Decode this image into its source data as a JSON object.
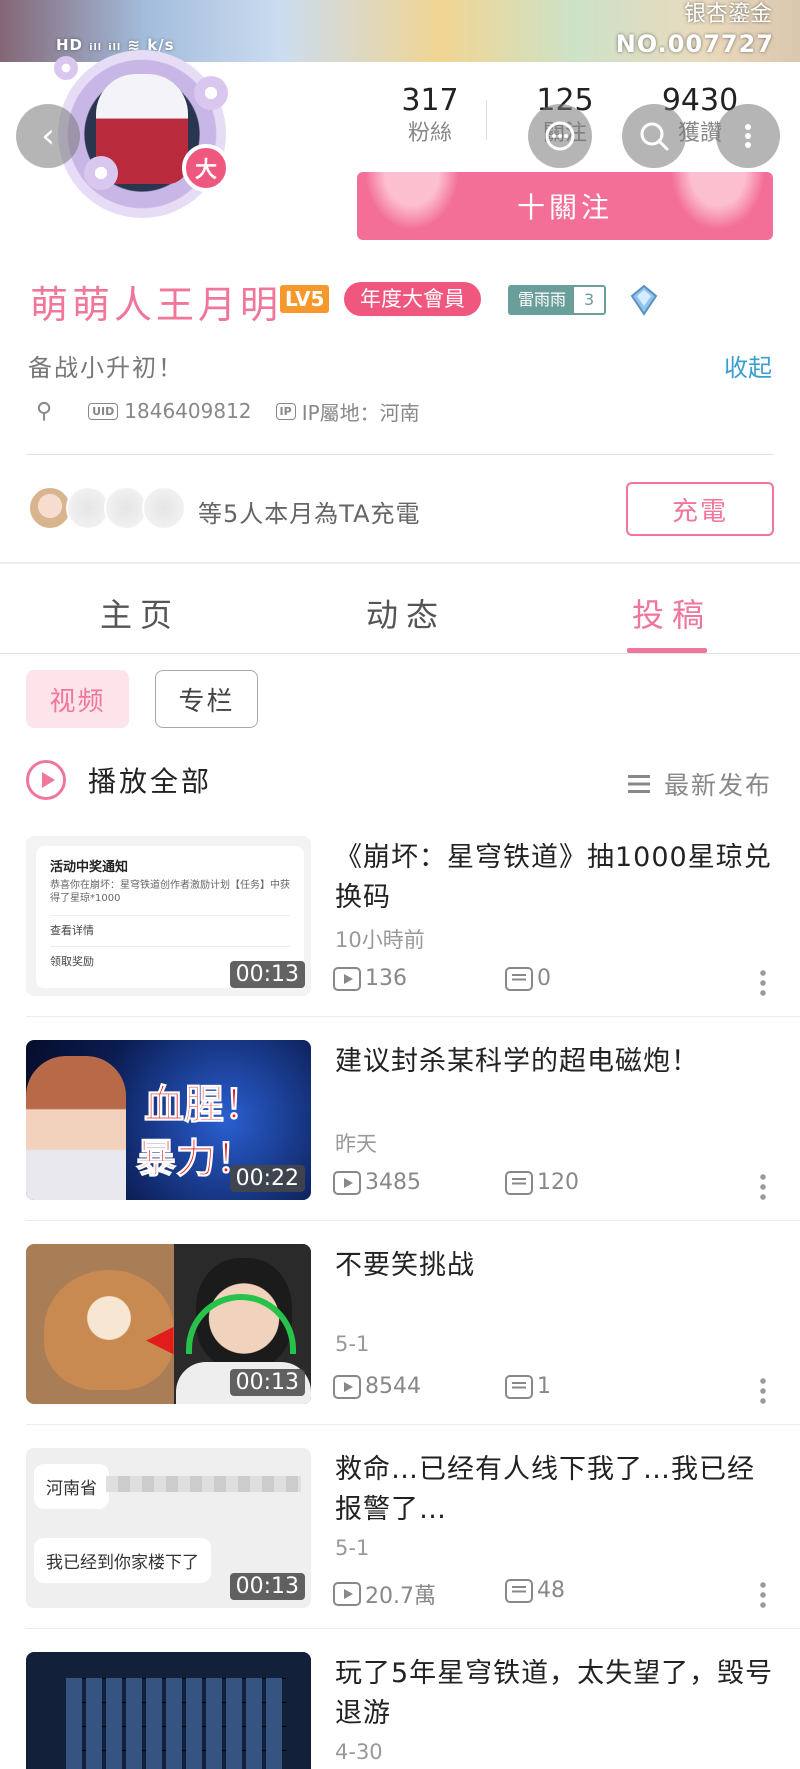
{
  "banner": {
    "medal_label": "银杏鎏金",
    "status_left": "HD ᵢₗₗ ᵢₗₗ ≋ k/s",
    "medal_number": "NO.007727"
  },
  "header": {
    "avatar_badge": "大",
    "stats": [
      {
        "num": "317",
        "label": "粉絲"
      },
      {
        "num": "125",
        "label": "關注"
      },
      {
        "num": "9430",
        "label": "獲讚"
      }
    ],
    "follow_label": "十關注"
  },
  "profile": {
    "name": "萌萌人王月明",
    "level": "LV5",
    "vip": "年度大會員",
    "fan_badge_name": "雷雨雨",
    "fan_badge_level": "3",
    "bio": "备战小升初！",
    "collapse_label": "收起",
    "uid_tag": "UID",
    "uid": "1846409812",
    "ip_tag": "IP",
    "ip": "IP屬地：河南"
  },
  "charge": {
    "text": "等5人本月為TA充電",
    "button": "充電"
  },
  "tabs": [
    {
      "label": "主页"
    },
    {
      "label": "动态"
    },
    {
      "label": "投稿"
    }
  ],
  "subtabs": {
    "video": "视频",
    "column": "专栏"
  },
  "list_header": {
    "play_all": "播放全部",
    "sort": "最新发布"
  },
  "videos": [
    {
      "title": "《崩坏：星穹铁道》抽1000星琼兑换码",
      "time": "10小時前",
      "plays": "136",
      "comments": "0",
      "duration": "00:13",
      "thumb_head": "活动中奖通知",
      "thumb_body": "恭喜你在崩坏：星穹铁道创作者激励计划【任务】中获得了星琼*1000",
      "thumb_row1": "查看详情",
      "thumb_row2": "领取奖励"
    },
    {
      "title": "建议封杀某科学的超电磁炮！",
      "time": "昨天",
      "plays": "3485",
      "comments": "120",
      "duration": "00:22",
      "thumb_line1": "血腥！",
      "thumb_line2": "暴力！"
    },
    {
      "title": "不要笑挑战",
      "time": "5-1",
      "plays": "8544",
      "comments": "1",
      "duration": "00:13"
    },
    {
      "title": "救命…已经有人线下我了…我已经报警了…",
      "time": "5-1",
      "plays": "20.7萬",
      "comments": "48",
      "duration": "00:13",
      "thumb_bubble1": "河南省",
      "thumb_bubble2": "我已经到你家楼下了"
    },
    {
      "title": "玩了5年星穹铁道，太失望了，毁号退游",
      "time": "4-30"
    }
  ]
}
